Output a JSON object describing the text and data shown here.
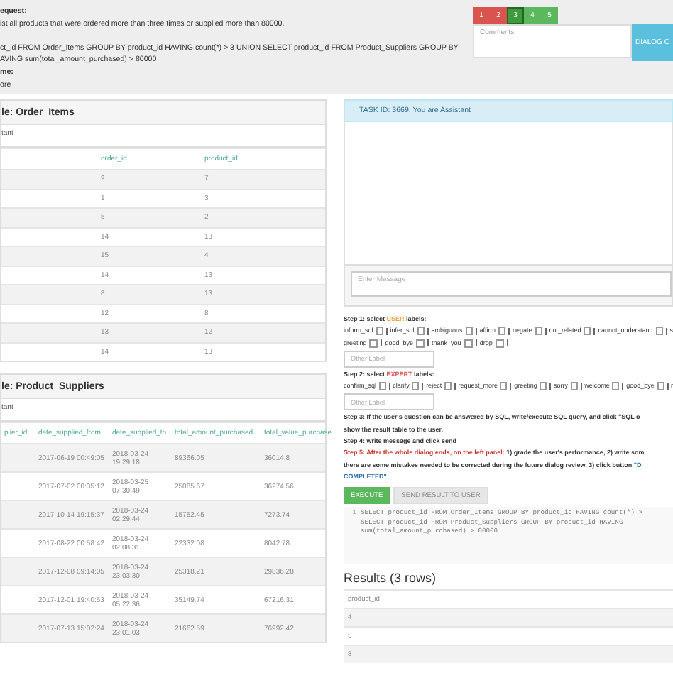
{
  "request": {
    "heading": "equest:",
    "text": "ist all products that were ordered more than three times or supplied more than 80000.",
    "sql_lines": [
      "ct_id FROM Order_Items GROUP BY product_id HAVING count(*) > 3 UNION SELECT product_id FROM Product_Suppliers GROUP BY",
      "AVING sum(total_amount_purchased) > 80000"
    ],
    "name_heading": "me:",
    "name_value": "ore"
  },
  "rating": [
    {
      "label": "1",
      "color": "#d9534f",
      "selected": false
    },
    {
      "label": "2",
      "color": "#d9534f",
      "selected": false
    },
    {
      "label": "3",
      "color": "#3d9b3d",
      "selected": true
    },
    {
      "label": "4",
      "color": "#5cb85c",
      "selected": false
    },
    {
      "label": "5",
      "color": "#5cb85c",
      "selected": false
    }
  ],
  "comments": {
    "placeholder": "Comments"
  },
  "dialog_button": {
    "label": "DIALOG C"
  },
  "order_items": {
    "title": "le: Order_Items",
    "subtitle": "tant",
    "columns": [
      "order_id",
      "product_id"
    ],
    "rows": [
      [
        "9",
        "7"
      ],
      [
        "1",
        "3"
      ],
      [
        "5",
        "2"
      ],
      [
        "14",
        "13"
      ],
      [
        "15",
        "4"
      ],
      [
        "14",
        "13"
      ],
      [
        "8",
        "13"
      ],
      [
        "12",
        "8"
      ],
      [
        "13",
        "12"
      ],
      [
        "14",
        "13"
      ]
    ]
  },
  "product_suppliers": {
    "title": "le: Product_Suppliers",
    "subtitle": "tant",
    "columns": [
      "plier_id",
      "date_supplied_from",
      "date_supplied_to",
      "total_amount_purchased",
      "total_value_purchase"
    ],
    "rows": [
      [
        "",
        "2017-06-19 00:49:05",
        "2018-03-24 19:29:18",
        "89366.05",
        "36014.8"
      ],
      [
        "",
        "2017-07-02 00:35:12",
        "2018-03-25 07:30:49",
        "25085.67",
        "36274.56"
      ],
      [
        "",
        "2017-10-14 19:15:37",
        "2018-03-24 02:29:44",
        "15752.45",
        "7273.74"
      ],
      [
        "",
        "2017-08-22 00:58:42",
        "2018-03-24 02:08:31",
        "22332.08",
        "8042.78"
      ],
      [
        "",
        "2017-12-08 09:14:05",
        "2018-03-24 23:03:30",
        "25318.21",
        "29836.28"
      ],
      [
        "",
        "2017-12-01 19:40:53",
        "2018-03-24 05:22:36",
        "35149.74",
        "67216.31"
      ],
      [
        "",
        "2017-07-13 15:02:24",
        "2018-03-24 23:01:03",
        "21662.59",
        "76992.42"
      ]
    ]
  },
  "task": {
    "header": "TASK ID: 3669, You are Assistant",
    "message": {
      "placeholder": "Enter Message"
    }
  },
  "instructions": [
    {
      "kind": "text",
      "lines": [
        [
          {
            "text": "Step 1: select ",
            "kind": "plain"
          },
          {
            "text": "USER",
            "kind": "user"
          },
          {
            "text": " labels:",
            "kind": "plain"
          }
        ]
      ]
    },
    {
      "kind": "labels",
      "rows": [
        {
          "items": [
            {
              "label": "inform_sql",
              "checked": false
            },
            {
              "label": "infer_sql",
              "checked": false
            },
            {
              "label": "ambiguous",
              "checked": false
            },
            {
              "label": "affirm",
              "checked": false
            },
            {
              "label": "negate",
              "checked": false
            },
            {
              "label": "not_related",
              "checked": false
            },
            {
              "label": "cannot_understand",
              "checked": false
            }
          ],
          "trailing": "s"
        },
        {
          "items": [
            {
              "label": "greeting",
              "checked": false
            },
            {
              "label": "good_bye",
              "checked": false
            },
            {
              "label": "thank_you",
              "checked": false
            },
            {
              "label": "drop",
              "checked": false
            }
          ]
        }
      ]
    },
    {
      "kind": "field",
      "placeholder": "Other Label"
    },
    {
      "kind": "text",
      "lines": [
        [
          {
            "text": "Step 2: select ",
            "kind": "plain"
          },
          {
            "text": "EXPERT",
            "kind": "expert"
          },
          {
            "text": " labels:",
            "kind": "plain"
          }
        ]
      ]
    },
    {
      "kind": "labels",
      "rows": [
        {
          "items": [
            {
              "label": "confirm_sql",
              "checked": false
            },
            {
              "label": "clarify",
              "checked": false
            },
            {
              "label": "reject",
              "checked": false
            },
            {
              "label": "request_more",
              "checked": false
            },
            {
              "label": "greeting",
              "checked": false
            },
            {
              "label": "sorry",
              "checked": false
            },
            {
              "label": "welcome",
              "checked": false
            },
            {
              "label": "good_bye",
              "checked": false
            }
          ],
          "trailing": "r"
        }
      ]
    },
    {
      "kind": "field",
      "placeholder": "Other Label"
    },
    {
      "kind": "text",
      "lines": [
        [
          {
            "text": "Step 3: If the user's question can be answered by SQL, write/execute SQL query, and click \"SQL o",
            "kind": "plain"
          }
        ],
        [
          {
            "text": "show the result table to the user.",
            "kind": "plain"
          }
        ]
      ]
    },
    {
      "kind": "text",
      "lines": [
        [
          {
            "text": "Step 4: write message and click send",
            "kind": "plain"
          }
        ]
      ]
    },
    {
      "kind": "text",
      "lines": [
        [
          {
            "text": "Step 5: After the whole dialog ends, on the left panel:",
            "kind": "alert"
          },
          {
            "text": " 1) grade the user's performance, 2) write som",
            "kind": "plain"
          }
        ],
        [
          {
            "text": "there are some mistakes needed to be corrected during the future dialog review. 3) click button ",
            "kind": "plain"
          },
          {
            "text": "\"D",
            "kind": "link"
          }
        ],
        [
          {
            "text": "COMPLETED\"",
            "kind": "link"
          }
        ]
      ]
    }
  ],
  "buttons": [
    {
      "label": "EXECUTE",
      "disabled": false
    },
    {
      "label": "SEND RESULT TO USER",
      "disabled": true
    }
  ],
  "sql_editor": {
    "line_number": "1",
    "lines": [
      "SELECT product_id FROM Order_Items GROUP BY product_id HAVING count(*) >",
      "SELECT product_id FROM Product_Suppliers GROUP BY product_id HAVING",
      "sum(total_amount_purchased) > 80000"
    ]
  },
  "results": {
    "title": "Results (3 rows)",
    "columns": [
      "product_id"
    ],
    "rows": [
      [
        "4"
      ],
      [
        "5"
      ],
      [
        "8"
      ]
    ]
  }
}
